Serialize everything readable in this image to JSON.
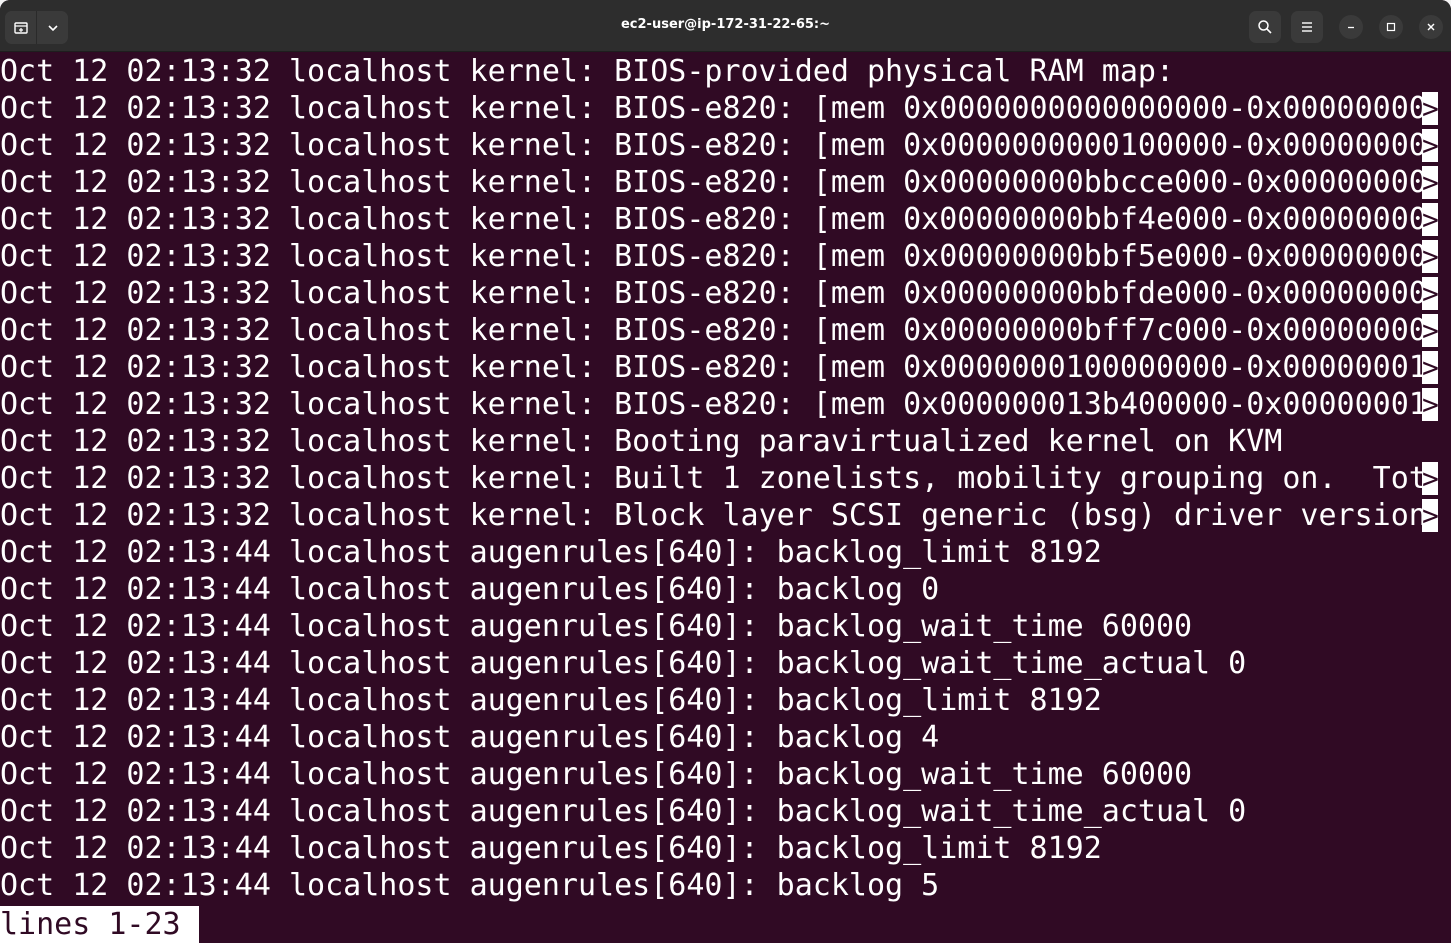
{
  "window": {
    "title": "ec2-user@ip-172-31-22-65:~"
  },
  "titlebar": {
    "left_buttons": [
      {
        "icon": "new-tab-icon"
      },
      {
        "icon": "chevron-down-icon"
      }
    ],
    "right_buttons": [
      {
        "icon": "search-icon"
      },
      {
        "icon": "hamburger-menu-icon"
      },
      {
        "icon": "minimize-icon"
      },
      {
        "icon": "maximize-icon"
      },
      {
        "icon": "close-icon"
      }
    ]
  },
  "terminal": {
    "background": "#300a24",
    "foreground": "#ffffff",
    "truncation_marker": ">",
    "lines": [
      {
        "text": "Oct 12 02:13:32 localhost kernel: BIOS-provided physical RAM map:",
        "truncated": false
      },
      {
        "text": "Oct 12 02:13:32 localhost kernel: BIOS-e820: [mem 0x0000000000000000-0x00000000",
        "truncated": true
      },
      {
        "text": "Oct 12 02:13:32 localhost kernel: BIOS-e820: [mem 0x0000000000100000-0x00000000",
        "truncated": true
      },
      {
        "text": "Oct 12 02:13:32 localhost kernel: BIOS-e820: [mem 0x00000000bbcce000-0x00000000",
        "truncated": true
      },
      {
        "text": "Oct 12 02:13:32 localhost kernel: BIOS-e820: [mem 0x00000000bbf4e000-0x00000000",
        "truncated": true
      },
      {
        "text": "Oct 12 02:13:32 localhost kernel: BIOS-e820: [mem 0x00000000bbf5e000-0x00000000",
        "truncated": true
      },
      {
        "text": "Oct 12 02:13:32 localhost kernel: BIOS-e820: [mem 0x00000000bbfde000-0x00000000",
        "truncated": true
      },
      {
        "text": "Oct 12 02:13:32 localhost kernel: BIOS-e820: [mem 0x00000000bff7c000-0x00000000",
        "truncated": true
      },
      {
        "text": "Oct 12 02:13:32 localhost kernel: BIOS-e820: [mem 0x0000000100000000-0x00000001",
        "truncated": true
      },
      {
        "text": "Oct 12 02:13:32 localhost kernel: BIOS-e820: [mem 0x000000013b400000-0x00000001",
        "truncated": true
      },
      {
        "text": "Oct 12 02:13:32 localhost kernel: Booting paravirtualized kernel on KVM",
        "truncated": false
      },
      {
        "text": "Oct 12 02:13:32 localhost kernel: Built 1 zonelists, mobility grouping on.  Tot",
        "truncated": true
      },
      {
        "text": "Oct 12 02:13:32 localhost kernel: Block layer SCSI generic (bsg) driver version",
        "truncated": true
      },
      {
        "text": "Oct 12 02:13:44 localhost augenrules[640]: backlog_limit 8192",
        "truncated": false
      },
      {
        "text": "Oct 12 02:13:44 localhost augenrules[640]: backlog 0",
        "truncated": false
      },
      {
        "text": "Oct 12 02:13:44 localhost augenrules[640]: backlog_wait_time 60000",
        "truncated": false
      },
      {
        "text": "Oct 12 02:13:44 localhost augenrules[640]: backlog_wait_time_actual 0",
        "truncated": false
      },
      {
        "text": "Oct 12 02:13:44 localhost augenrules[640]: backlog_limit 8192",
        "truncated": false
      },
      {
        "text": "Oct 12 02:13:44 localhost augenrules[640]: backlog 4",
        "truncated": false
      },
      {
        "text": "Oct 12 02:13:44 localhost augenrules[640]: backlog_wait_time 60000",
        "truncated": false
      },
      {
        "text": "Oct 12 02:13:44 localhost augenrules[640]: backlog_wait_time_actual 0",
        "truncated": false
      },
      {
        "text": "Oct 12 02:13:44 localhost augenrules[640]: backlog_limit 8192",
        "truncated": false
      },
      {
        "text": "Oct 12 02:13:44 localhost augenrules[640]: backlog 5",
        "truncated": false
      }
    ],
    "status_line": "lines 1-23"
  }
}
